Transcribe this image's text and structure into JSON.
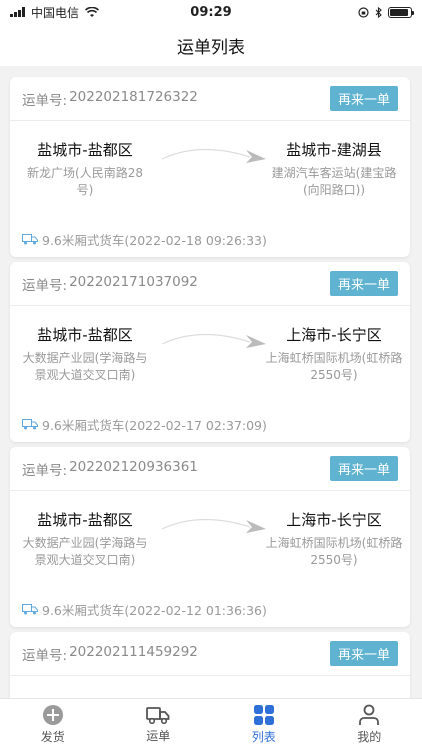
{
  "status": {
    "carrier": "中国电信",
    "time": "09:29"
  },
  "header": {
    "title": "运单列表"
  },
  "orders": [
    {
      "label": "运单号:",
      "number": "202202181726322",
      "button": "再来一单",
      "from_city": "盐城市-盐都区",
      "from_addr": "新龙广场(人民南路28号)",
      "to_city": "盐城市-建湖县",
      "to_addr": "建湖汽车客运站(建宝路(向阳路口))",
      "vehicle": "9.6米厢式货车(2022-02-18 09:26:33)"
    },
    {
      "label": "运单号:",
      "number": "202202171037092",
      "button": "再来一单",
      "from_city": "盐城市-盐都区",
      "from_addr": "大数据产业园(学海路与景观大道交叉口南)",
      "to_city": "上海市-长宁区",
      "to_addr": "上海虹桥国际机场(虹桥路2550号)",
      "vehicle": "9.6米厢式货车(2022-02-17 02:37:09)"
    },
    {
      "label": "运单号:",
      "number": "202202120936361",
      "button": "再来一单",
      "from_city": "盐城市-盐都区",
      "from_addr": "大数据产业园(学海路与景观大道交叉口南)",
      "to_city": "上海市-长宁区",
      "to_addr": "上海虹桥国际机场(虹桥路2550号)",
      "vehicle": "9.6米厢式货车(2022-02-12 01:36:36)"
    },
    {
      "label": "运单号:",
      "number": "202202111459292",
      "button": "再来一单"
    }
  ],
  "tabs": [
    {
      "label": "发货",
      "icon": "add-circle-icon"
    },
    {
      "label": "运单",
      "icon": "truck-icon"
    },
    {
      "label": "列表",
      "icon": "grid-icon"
    },
    {
      "label": "我的",
      "icon": "user-icon"
    }
  ],
  "colors": {
    "accent": "#2f6fd8",
    "button": "#5fb3d0"
  }
}
